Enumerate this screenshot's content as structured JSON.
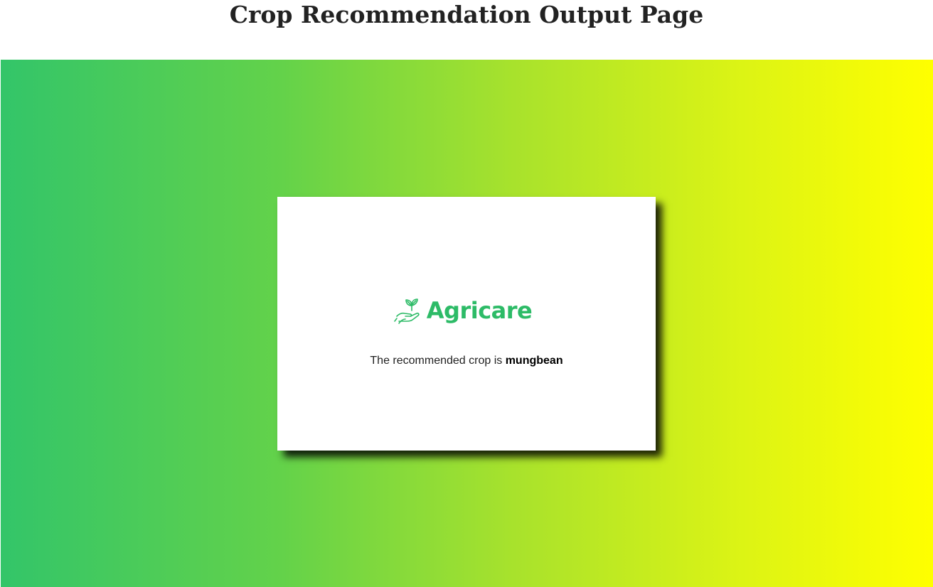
{
  "page": {
    "title": "Crop Recommendation Output Page"
  },
  "card": {
    "brand": {
      "name": "Agricare",
      "icon": "hand-sprout-icon",
      "color": "#2dbb67"
    },
    "result_prefix": "The recommended crop is",
    "crop": "mungbean"
  },
  "theme": {
    "gradient_start": "#33c569",
    "gradient_end": "#ffff00"
  }
}
